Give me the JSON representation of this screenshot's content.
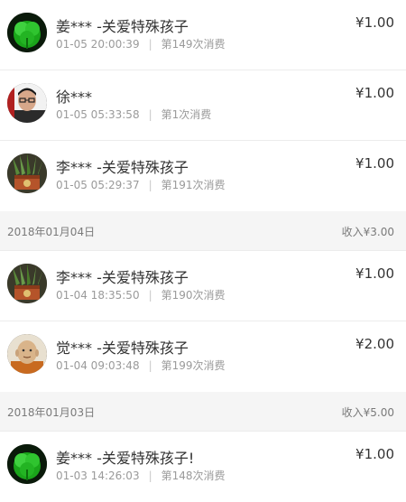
{
  "currency_symbol": "¥",
  "records_group_1": [
    {
      "name": "姜*** -关爱特殊孩子",
      "time": "01-05 20:00:39",
      "count": "第149次消费",
      "amount": "¥1.00",
      "avatar": "green-clover"
    },
    {
      "name": "徐***",
      "time": "01-05 05:33:58",
      "count": "第1次消费",
      "amount": "¥1.00",
      "avatar": "man-glasses"
    },
    {
      "name": "李*** -关爱特殊孩子",
      "time": "01-05 05:29:37",
      "count": "第191次消费",
      "amount": "¥1.00",
      "avatar": "plant-pot"
    }
  ],
  "day_2": {
    "date": "2018年01月04日",
    "income": "收入¥3.00"
  },
  "records_group_2": [
    {
      "name": "李*** -关爱特殊孩子",
      "time": "01-04 18:35:50",
      "count": "第190次消费",
      "amount": "¥1.00",
      "avatar": "plant-pot"
    },
    {
      "name": "觉*** -关爱特殊孩子",
      "time": "01-04 09:03:48",
      "count": "第199次消费",
      "amount": "¥2.00",
      "avatar": "monk"
    }
  ],
  "day_3": {
    "date": "2018年01月03日",
    "income": "收入¥5.00"
  },
  "records_group_3": [
    {
      "name": "姜*** -关爱特殊孩子!",
      "time": "01-03 14:26:03",
      "count": "第148次消费",
      "amount": "¥1.00",
      "avatar": "green-clover"
    }
  ]
}
